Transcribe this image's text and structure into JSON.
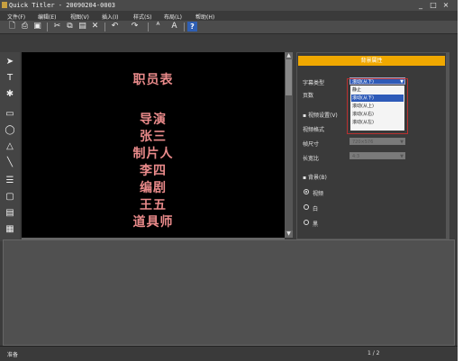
{
  "window": {
    "title": "Quick Titler - 20090204-0003",
    "controls": [
      "_",
      "□",
      "×"
    ]
  },
  "menu": [
    "文件(F)",
    "编辑(E)",
    "视图(V)",
    "插入(I)",
    "样式(S)",
    "布局(L)",
    "帮助(H)"
  ],
  "toolbar": {
    "help_label": "?"
  },
  "canvas": {
    "credits_title": "职员表",
    "credits": [
      "导演",
      "张三",
      "制片人",
      "李四",
      "编剧",
      "王五",
      "道具师"
    ]
  },
  "panel": {
    "header": "背景属性",
    "subtitle_type_label": "字幕类型",
    "subtitle_type_value": "滚动(从下)",
    "page_label": "页数",
    "video_settings_label": "视频设置(V)",
    "video_format_label": "视频格式",
    "frame_size_label": "帧尺寸",
    "frame_size_value": "720×576",
    "aspect_label": "长宽比",
    "aspect_value": "4:3",
    "background_label": "背景(B)",
    "bg_options": [
      "视频",
      "白",
      "黑"
    ],
    "dropdown_options": [
      "静止",
      "滚动(从下)",
      "滚动(从上)",
      "滚动(从右)",
      "滚动(从左)"
    ],
    "dropdown_selected_index": 1
  },
  "status": {
    "left": "准备",
    "page": "1 / 2"
  },
  "colors": {
    "panel_header": "#f0a800",
    "credit_text": "#e98a8a",
    "selection": "#2d5ab8",
    "highlight_box": "#b83030"
  }
}
